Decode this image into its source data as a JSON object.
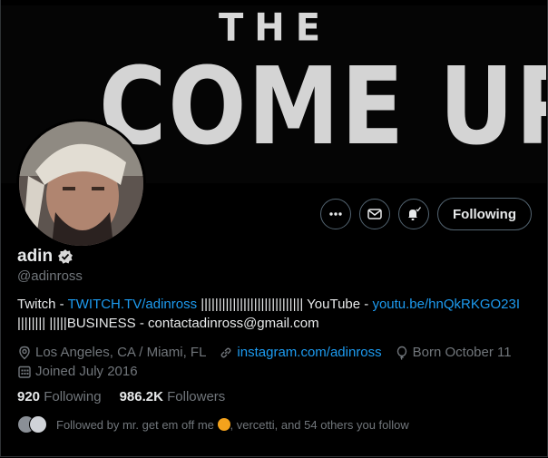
{
  "banner": {
    "line1": "THE",
    "line2": "COME UP"
  },
  "actions": {
    "follow_label": "Following"
  },
  "profile": {
    "name": "adin",
    "handle": "@adinross",
    "bio": {
      "p1": "Twitch - ",
      "link1": "TWITCH.TV/adinross",
      "p2": " ||||||||||||||||||||||||||||| YouTube - ",
      "link2": "youtu.be/hnQkRKGO23I",
      "p3": " |||||||| |||||BUSINESS - contactadinross@gmail.com"
    },
    "location": "Los Angeles, CA / Miami, FL",
    "website": "instagram.com/adinross",
    "born": "Born October 11",
    "joined": "Joined July 2016"
  },
  "counts": {
    "following_value": "920",
    "following_label": "Following",
    "followers_value": "986.2K",
    "followers_label": "Followers"
  },
  "followed_by": {
    "prefix": "Followed by mr. get em off me ",
    "suffix": ", vercetti, and 54 others you follow"
  },
  "colors": {
    "link": "#1d9bf0",
    "muted": "#71767b",
    "text": "#e7e9ea"
  }
}
